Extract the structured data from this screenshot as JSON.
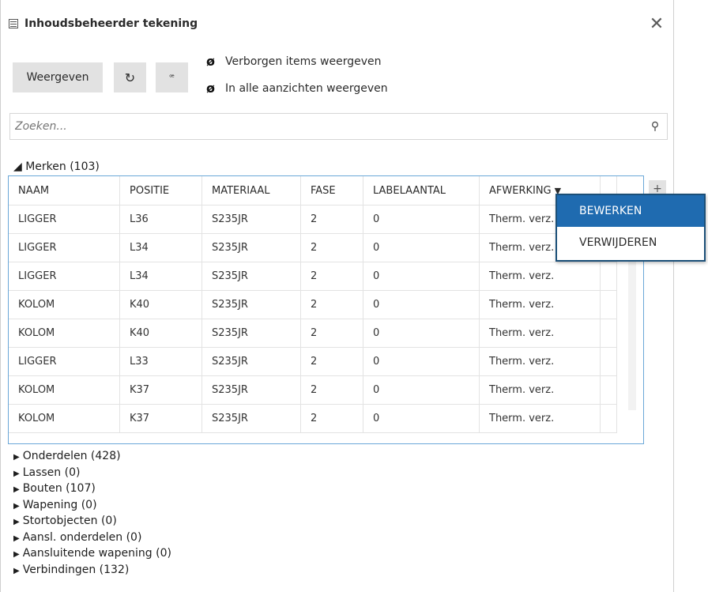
{
  "title": "Inhoudsbeheerder tekening",
  "toolbar": {
    "show_label": "Weergeven",
    "refresh_glyph": "↻",
    "tag_glyph": "ꟹ",
    "toggle_hidden": "Verborgen items weergeven",
    "toggle_all_views": "In alle aanzichten weergeven"
  },
  "search": {
    "placeholder": "Zoeken..."
  },
  "section": {
    "title": "◢ Merken (103)"
  },
  "table": {
    "columns": [
      "NAAM",
      "POSITIE",
      "MATERIAAL",
      "FASE",
      "LABELAANTAL",
      "AFWERKING"
    ],
    "sort_indicator": "▼",
    "rows": [
      [
        "LIGGER",
        "L36",
        "S235JR",
        "2",
        "0",
        "Therm. verz."
      ],
      [
        "LIGGER",
        "L34",
        "S235JR",
        "2",
        "0",
        "Therm. verz."
      ],
      [
        "LIGGER",
        "L34",
        "S235JR",
        "2",
        "0",
        "Therm. verz."
      ],
      [
        "KOLOM",
        "K40",
        "S235JR",
        "2",
        "0",
        "Therm. verz."
      ],
      [
        "KOLOM",
        "K40",
        "S235JR",
        "2",
        "0",
        "Therm. verz."
      ],
      [
        "LIGGER",
        "L33",
        "S235JR",
        "2",
        "0",
        "Therm. verz."
      ],
      [
        "KOLOM",
        "K37",
        "S235JR",
        "2",
        "0",
        "Therm. verz."
      ],
      [
        "KOLOM",
        "K37",
        "S235JR",
        "2",
        "0",
        "Therm. verz."
      ]
    ]
  },
  "context_menu": {
    "edit": "BEWERKEN",
    "delete": "VERWIJDEREN"
  },
  "groups": [
    "Onderdelen (428)",
    "Lassen (0)",
    "Bouten (107)",
    "Wapening (0)",
    "Stortobjecten (0)",
    "Aansl. onderdelen (0)",
    "Aansluitende wapening (0)",
    "Verbindingen (132)"
  ],
  "icons": {
    "close": "close-icon",
    "eye_hidden": "eye-slash-icon",
    "search": "search-icon",
    "collapsed": "triangle-right-icon"
  },
  "colors": {
    "menu_highlight": "#1f6bb0",
    "grid_border": "#6aa7d8"
  }
}
